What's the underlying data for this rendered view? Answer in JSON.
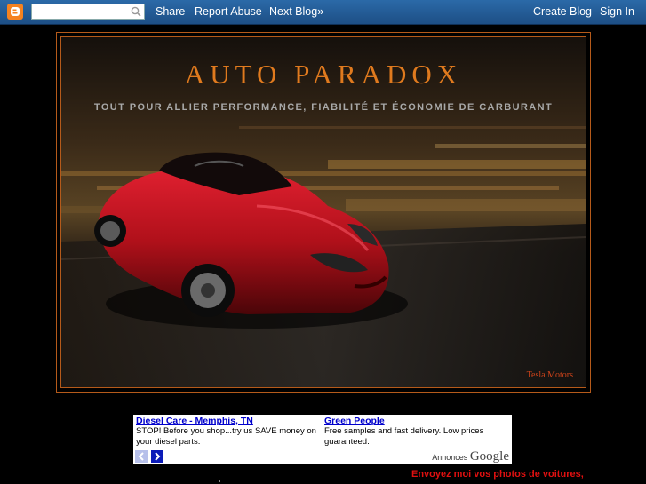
{
  "navbar": {
    "search": {
      "value": "",
      "placeholder": ""
    },
    "share": "Share",
    "report_abuse": "Report Abuse",
    "next_blog": "Next Blog»",
    "create_blog": "Create Blog",
    "sign_in": "Sign In"
  },
  "header": {
    "title": "AUTO PARADOX",
    "description": "TOUT POUR ALLIER PERFORMANCE, FIABILITÉ ET ÉCONOMIE DE CARBURANT",
    "photo_credit": "Tesla Motors"
  },
  "ads": {
    "items": [
      {
        "title": "Diesel Care - Memphis, TN",
        "text": "STOP! Before you shop...try us SAVE money on your diesel parts."
      },
      {
        "title": "Green People",
        "text": "Free samples and fast delivery. Low prices guaranteed."
      }
    ],
    "label": "Annonces",
    "brand": "Google"
  },
  "sidebar": {
    "send_photos": "Envoyez moi vos photos de voitures,"
  },
  "colors": {
    "navbar": "#2b6aa8",
    "title": "#e07a1e",
    "frame": "#b55a1a",
    "car": "#b0101a",
    "link": "#0000cc",
    "sidebar_text": "#e01010"
  }
}
